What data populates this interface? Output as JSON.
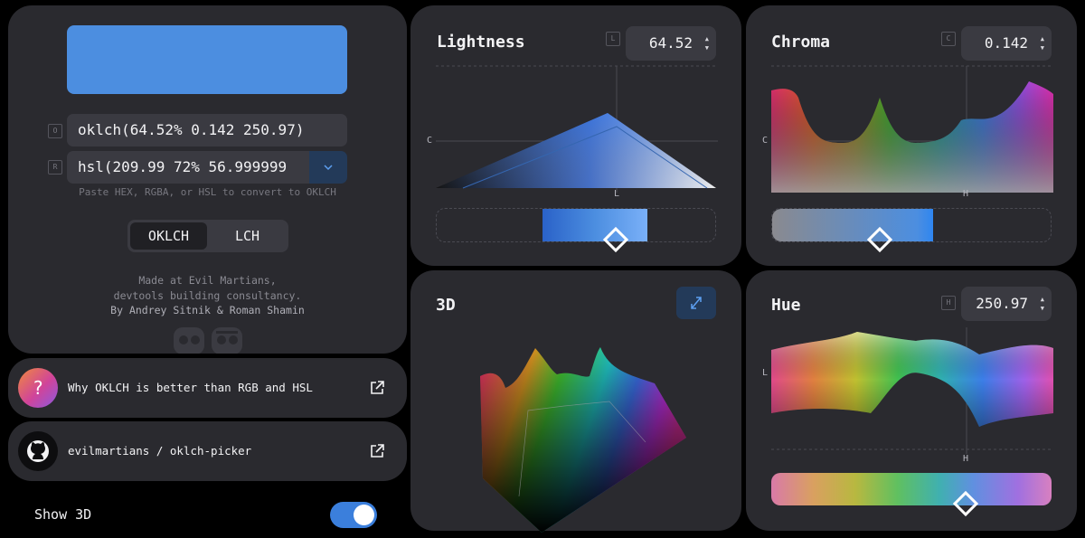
{
  "color": {
    "swatch": "#4c8ee0",
    "oklch_tag": "O",
    "oklch_value": "oklch(64.52% 0.142 250.97)",
    "rgb_tag": "R",
    "rgb_value": "hsl(209.99 72% 56.999999",
    "hint": "Paste HEX, RGBA, or HSL to convert to OKLCH"
  },
  "mode": {
    "options": [
      "OKLCH",
      "LCH"
    ],
    "selected": "OKLCH"
  },
  "credits": [
    "Made at Evil Martians,",
    "devtools building consultancy.",
    "By Andrey Sitnik & Roman Shamin"
  ],
  "links": [
    {
      "icon": "question-icon",
      "icon_glyph": "?",
      "text": "Why OKLCH is better than RGB and HSL"
    },
    {
      "icon": "github-icon",
      "text": "evilmartians / oklch-picker"
    }
  ],
  "show3d": {
    "label": "Show 3D",
    "enabled": true
  },
  "lightness": {
    "title": "Lightness",
    "tag": "L",
    "value": "64.52",
    "y_axis": "C",
    "x_axis": "L",
    "slider_position": 0.6452
  },
  "chroma": {
    "title": "Chroma",
    "tag": "C",
    "value": "0.142",
    "y_axis": "C",
    "x_axis": "H",
    "slider_position": 0.38
  },
  "three_d": {
    "title": "3D",
    "expand_icon": "expand-icon"
  },
  "hue": {
    "title": "Hue",
    "tag": "H",
    "value": "250.97",
    "y_axis": "L",
    "x_axis": "H",
    "slider_position": 0.697
  },
  "colors": {
    "accent": "#3b7fdc",
    "panel": "#2a2a2f",
    "field": "#3a3a41",
    "background": "#000000"
  }
}
